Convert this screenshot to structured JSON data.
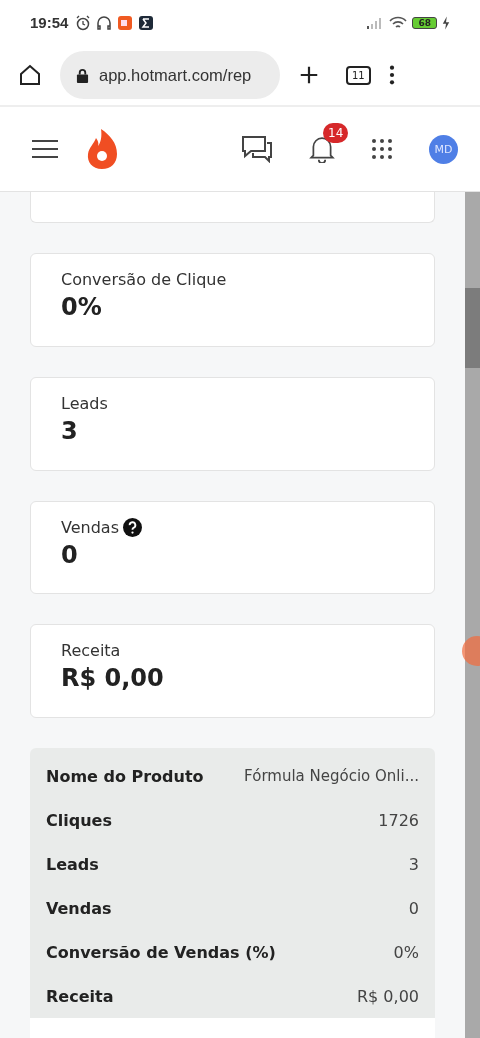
{
  "status_bar": {
    "time": "19:54",
    "battery": "68"
  },
  "browser": {
    "url": "app.hotmart.com/rep",
    "tab_count": "11"
  },
  "header": {
    "notification_count": "14",
    "avatar_initials": "MD"
  },
  "metrics": [
    {
      "label": "Conversão de Clique",
      "value": "0%",
      "help": false
    },
    {
      "label": "Leads",
      "value": "3",
      "help": false
    },
    {
      "label": "Vendas",
      "value": "0",
      "help": true
    },
    {
      "label": "Receita",
      "value": "R$ 0,00",
      "help": false
    }
  ],
  "table": {
    "rows": [
      {
        "label": "Nome do Produto",
        "value": "Fórmula Negócio Onli..."
      },
      {
        "label": "Cliques",
        "value": "1726"
      },
      {
        "label": "Leads",
        "value": "3"
      },
      {
        "label": "Vendas",
        "value": "0"
      },
      {
        "label": "Conversão de Vendas (%)",
        "value": "0%"
      },
      {
        "label": "Receita",
        "value": "R$ 0,00"
      }
    ]
  }
}
